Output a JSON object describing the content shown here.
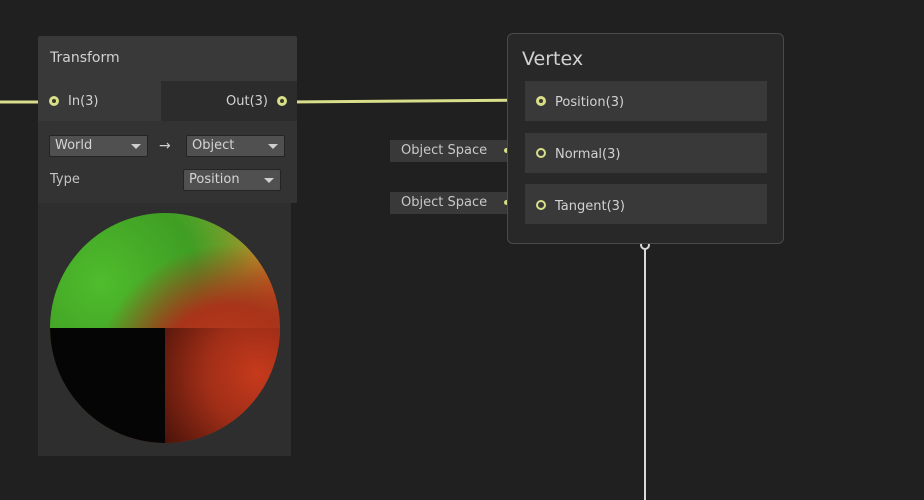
{
  "transform_node": {
    "title": "Transform",
    "input_port": "In(3)",
    "output_port": "Out(3)",
    "from_space": "World",
    "arrow": "→",
    "to_space": "Object",
    "type_label": "Type",
    "type_value": "Position"
  },
  "vertex_node": {
    "title": "Vertex",
    "ports": [
      {
        "label": "Position(3)"
      },
      {
        "label": "Normal(3)"
      },
      {
        "label": "Tangent(3)"
      }
    ]
  },
  "space_chips": [
    {
      "label": "Object Space"
    },
    {
      "label": "Object Space"
    }
  ],
  "colors": {
    "background": "#202020",
    "wire_vector3": "#d8de8a",
    "wire_output": "#d8d8d8",
    "node_header": "#393939"
  }
}
